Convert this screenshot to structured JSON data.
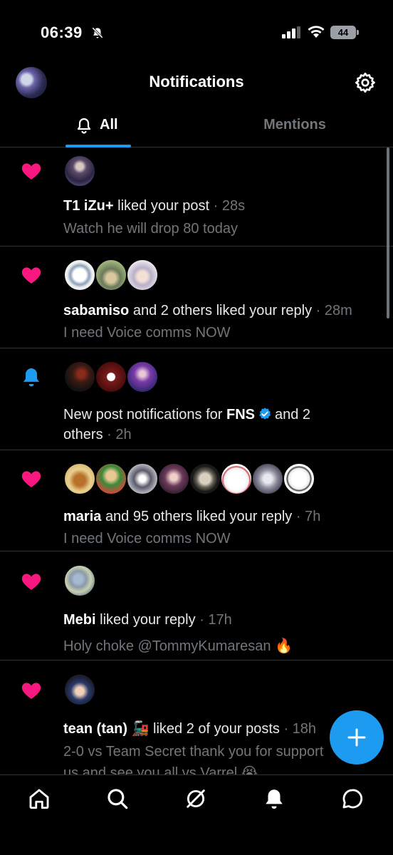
{
  "status_bar": {
    "time": "06:39",
    "battery": "44"
  },
  "header": {
    "title": "Notifications"
  },
  "tabs": [
    {
      "label": "All"
    },
    {
      "label": "Mentions"
    }
  ],
  "notifications": [
    {
      "icon": "heart-icon",
      "user": "T1 iZu+",
      "action": "liked your post",
      "time": "· 28s",
      "preview": "Watch he will drop 80 today"
    },
    {
      "icon": "heart-icon",
      "user": "sabamiso",
      "action": "and 2 others liked your reply",
      "time": "· 28m",
      "preview": "I need Voice comms NOW"
    },
    {
      "icon": "bell-icon",
      "prefix": "New post notifications for",
      "user": "FNS",
      "action": "and 2",
      "line2": "others",
      "time": "· 2h"
    },
    {
      "icon": "heart-icon",
      "user": "maria",
      "action": "and 95 others liked your reply",
      "time": "· 7h",
      "preview": "I need Voice comms NOW"
    },
    {
      "icon": "heart-icon",
      "user": "Mebi",
      "action": "liked your reply",
      "time": "· 17h",
      "preview": "Holy choke @TommyKumaresan 🔥"
    },
    {
      "icon": "heart-icon",
      "user": "tean (tan) 🚂",
      "action": "liked 2 of your posts",
      "time": "· 18h",
      "preview": "2-0 vs Team Secret thank you for support",
      "preview2": "us and see you all vs Varrel 😭"
    }
  ],
  "colors": {
    "accent": "#1d9bf0",
    "heart": "#f91880",
    "background": "#000000",
    "muted": "#71767b"
  }
}
